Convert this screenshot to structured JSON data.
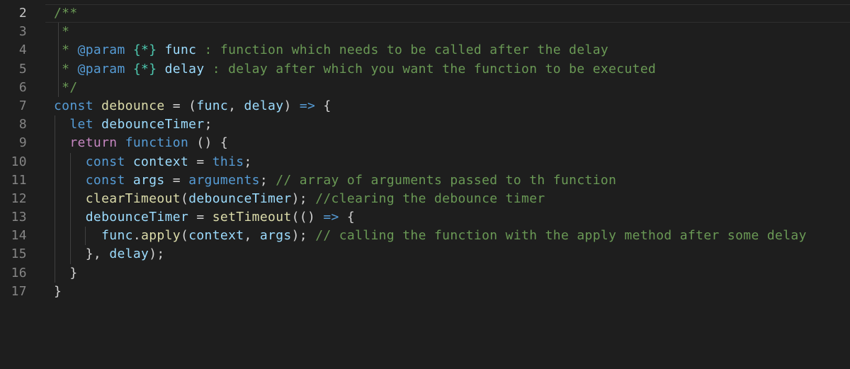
{
  "editor": {
    "line_numbers": [
      "2",
      "3",
      "4",
      "5",
      "6",
      "7",
      "8",
      "9",
      "10",
      "11",
      "12",
      "13",
      "14",
      "15",
      "16",
      "17"
    ],
    "lines": [
      {
        "tokens": [
          {
            "t": "/**",
            "c": "doc"
          }
        ]
      },
      {
        "tokens": [
          {
            "t": " *",
            "c": "doc"
          }
        ]
      },
      {
        "tokens": [
          {
            "t": " * ",
            "c": "doc"
          },
          {
            "t": "@param",
            "c": "tag"
          },
          {
            "t": " ",
            "c": "doc"
          },
          {
            "t": "{*}",
            "c": "typ"
          },
          {
            "t": " ",
            "c": "doc"
          },
          {
            "t": "func",
            "c": "var"
          },
          {
            "t": " : function which needs to be called after the delay",
            "c": "doc"
          }
        ]
      },
      {
        "tokens": [
          {
            "t": " * ",
            "c": "doc"
          },
          {
            "t": "@param",
            "c": "tag"
          },
          {
            "t": " ",
            "c": "doc"
          },
          {
            "t": "{*}",
            "c": "typ"
          },
          {
            "t": " ",
            "c": "doc"
          },
          {
            "t": "delay",
            "c": "var"
          },
          {
            "t": " : delay after which you want the function to be executed",
            "c": "doc"
          }
        ]
      },
      {
        "tokens": [
          {
            "t": " */",
            "c": "doc"
          }
        ]
      },
      {
        "tokens": [
          {
            "t": "const",
            "c": "kw"
          },
          {
            "t": " ",
            "c": "op"
          },
          {
            "t": "debounce",
            "c": "fn"
          },
          {
            "t": " = (",
            "c": "op"
          },
          {
            "t": "func",
            "c": "var"
          },
          {
            "t": ", ",
            "c": "op"
          },
          {
            "t": "delay",
            "c": "var"
          },
          {
            "t": ") ",
            "c": "op"
          },
          {
            "t": "=>",
            "c": "kw"
          },
          {
            "t": " {",
            "c": "op"
          }
        ]
      },
      {
        "tokens": [
          {
            "t": "  ",
            "c": "op"
          },
          {
            "t": "let",
            "c": "kw"
          },
          {
            "t": " ",
            "c": "op"
          },
          {
            "t": "debounceTimer",
            "c": "var"
          },
          {
            "t": ";",
            "c": "op"
          }
        ]
      },
      {
        "tokens": [
          {
            "t": "  ",
            "c": "op"
          },
          {
            "t": "return",
            "c": "ctl"
          },
          {
            "t": " ",
            "c": "op"
          },
          {
            "t": "function",
            "c": "kw"
          },
          {
            "t": " () {",
            "c": "op"
          }
        ]
      },
      {
        "tokens": [
          {
            "t": "    ",
            "c": "op"
          },
          {
            "t": "const",
            "c": "kw"
          },
          {
            "t": " ",
            "c": "op"
          },
          {
            "t": "context",
            "c": "var"
          },
          {
            "t": " = ",
            "c": "op"
          },
          {
            "t": "this",
            "c": "kw"
          },
          {
            "t": ";",
            "c": "op"
          }
        ]
      },
      {
        "tokens": [
          {
            "t": "    ",
            "c": "op"
          },
          {
            "t": "const",
            "c": "kw"
          },
          {
            "t": " ",
            "c": "op"
          },
          {
            "t": "args",
            "c": "var"
          },
          {
            "t": " = ",
            "c": "op"
          },
          {
            "t": "arguments",
            "c": "kw"
          },
          {
            "t": "; ",
            "c": "op"
          },
          {
            "t": "// array of arguments passed to th function",
            "c": "cm"
          }
        ]
      },
      {
        "tokens": [
          {
            "t": "    ",
            "c": "op"
          },
          {
            "t": "clearTimeout",
            "c": "fn"
          },
          {
            "t": "(",
            "c": "op"
          },
          {
            "t": "debounceTimer",
            "c": "var"
          },
          {
            "t": "); ",
            "c": "op"
          },
          {
            "t": "//clearing the debounce timer",
            "c": "cm"
          }
        ]
      },
      {
        "tokens": [
          {
            "t": "    ",
            "c": "op"
          },
          {
            "t": "debounceTimer",
            "c": "var"
          },
          {
            "t": " = ",
            "c": "op"
          },
          {
            "t": "setTimeout",
            "c": "fn"
          },
          {
            "t": "(() ",
            "c": "op"
          },
          {
            "t": "=>",
            "c": "kw"
          },
          {
            "t": " {",
            "c": "op"
          }
        ]
      },
      {
        "tokens": [
          {
            "t": "      ",
            "c": "op"
          },
          {
            "t": "func",
            "c": "var"
          },
          {
            "t": ".",
            "c": "op"
          },
          {
            "t": "apply",
            "c": "fn"
          },
          {
            "t": "(",
            "c": "op"
          },
          {
            "t": "context",
            "c": "var"
          },
          {
            "t": ", ",
            "c": "op"
          },
          {
            "t": "args",
            "c": "var"
          },
          {
            "t": "); ",
            "c": "op"
          },
          {
            "t": "// calling the function with the apply method after some delay",
            "c": "cm"
          }
        ]
      },
      {
        "tokens": [
          {
            "t": "    }, ",
            "c": "op"
          },
          {
            "t": "delay",
            "c": "var"
          },
          {
            "t": ");",
            "c": "op"
          }
        ]
      },
      {
        "tokens": [
          {
            "t": "  }",
            "c": "op"
          }
        ]
      },
      {
        "tokens": [
          {
            "t": "}",
            "c": "op"
          }
        ]
      }
    ]
  }
}
